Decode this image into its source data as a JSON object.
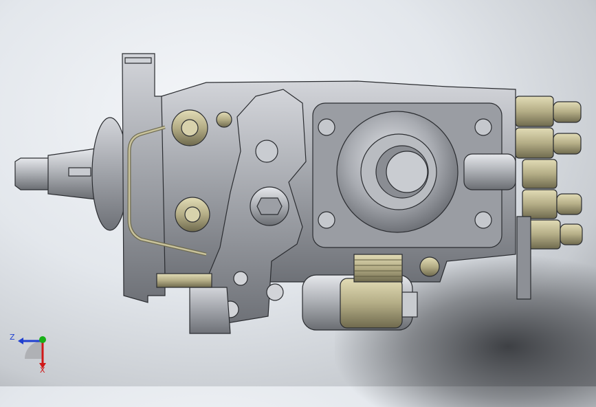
{
  "triad": {
    "z_label": "Z",
    "x_label": "X",
    "colors": {
      "z": "#2040d0",
      "x": "#d01818",
      "y": "#18b018"
    }
  },
  "model": {
    "icon": "injection-pump-3d-model",
    "colors": {
      "metal": "#a9acb2",
      "metal_dark": "#6d7076",
      "brass": "#b6b08a",
      "outline": "#2a2c30"
    }
  }
}
